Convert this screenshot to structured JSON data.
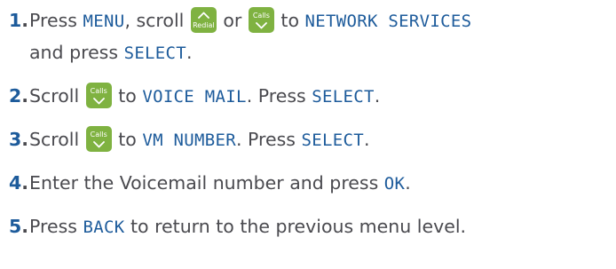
{
  "steps": [
    {
      "number": "1",
      "segments": {
        "s1": "Press ",
        "k1": "MENU",
        "s2": ", scroll ",
        "key_up_label": "Redial",
        "s3": " or ",
        "key_down_label": "Calls",
        "s4": " to ",
        "k2": "NETWORK SERVICES",
        "s5": "and press ",
        "k3": "SELECT",
        "s6": "."
      }
    },
    {
      "number": "2",
      "segments": {
        "s1": "Scroll ",
        "key_down_label": "Calls",
        "s2": " to ",
        "k1": "VOICE MAIL",
        "s3": ". Press ",
        "k2": "SELECT",
        "s4": "."
      }
    },
    {
      "number": "3",
      "segments": {
        "s1": "Scroll ",
        "key_down_label": "Calls",
        "s2": " to ",
        "k1": "VM NUMBER",
        "s3": ". Press ",
        "k2": "SELECT",
        "s4": "."
      }
    },
    {
      "number": "4",
      "segments": {
        "s1": "Enter the Voicemail number and press ",
        "k1": "OK",
        "s2": "."
      }
    },
    {
      "number": "5",
      "segments": {
        "s1": "Press ",
        "k1": "BACK",
        "s2": " to return to the previous menu level."
      }
    }
  ],
  "number_suffix": ".",
  "colors": {
    "text": "#4a4a4f",
    "accent": "#1d5b9b",
    "key_background": "#7fb241"
  },
  "icons": {
    "redial_key": "chevron-up-icon",
    "calls_key": "chevron-down-icon"
  }
}
